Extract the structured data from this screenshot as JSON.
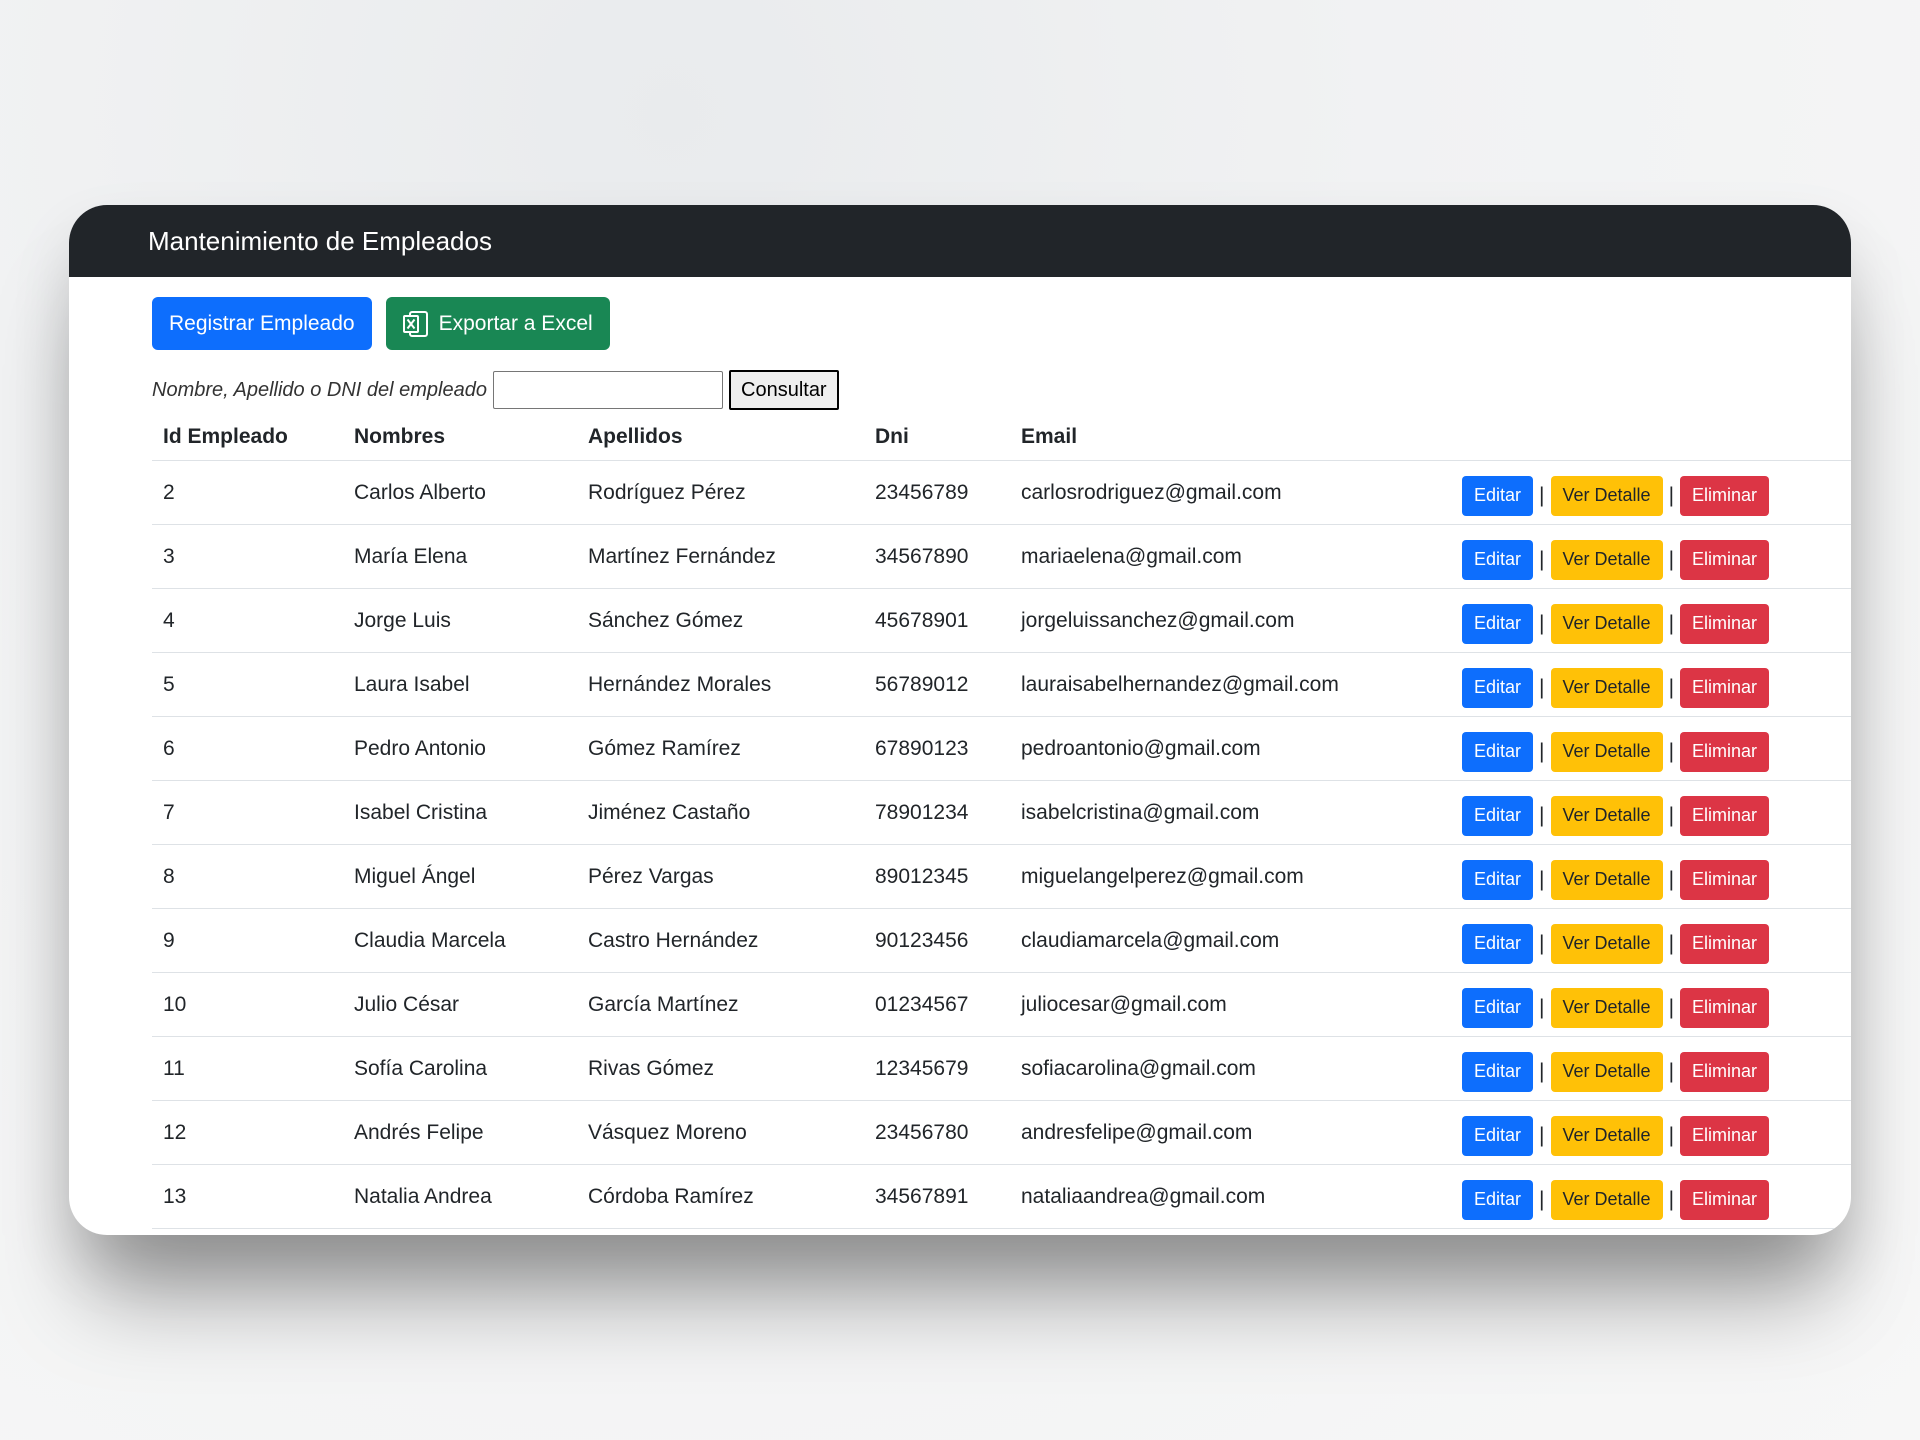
{
  "header": {
    "title": "Mantenimiento de Empleados"
  },
  "actions": {
    "register_label": "Registrar Empleado",
    "export_label": "Exportar a Excel",
    "export_icon": "excel-icon"
  },
  "search": {
    "label": "Nombre, Apellido o DNI del empleado",
    "value": "",
    "button_label": "Consultar"
  },
  "table": {
    "columns": [
      "Id Empleado",
      "Nombres",
      "Apellidos",
      "Dni",
      "Email",
      ""
    ],
    "row_actions": {
      "edit": "Editar",
      "detail": "Ver Detalle",
      "delete": "Eliminar",
      "separator": "|"
    },
    "rows": [
      {
        "id": "2",
        "nombres": "Carlos Alberto",
        "apellidos": "Rodríguez Pérez",
        "dni": "23456789",
        "email": "carlosrodriguez@gmail.com"
      },
      {
        "id": "3",
        "nombres": "María Elena",
        "apellidos": "Martínez Fernández",
        "dni": "34567890",
        "email": "mariaelena@gmail.com"
      },
      {
        "id": "4",
        "nombres": "Jorge Luis",
        "apellidos": "Sánchez Gómez",
        "dni": "45678901",
        "email": "jorgeluissanchez@gmail.com"
      },
      {
        "id": "5",
        "nombres": "Laura Isabel",
        "apellidos": "Hernández Morales",
        "dni": "56789012",
        "email": "lauraisabelhernandez@gmail.com"
      },
      {
        "id": "6",
        "nombres": "Pedro Antonio",
        "apellidos": "Gómez Ramírez",
        "dni": "67890123",
        "email": "pedroantonio@gmail.com"
      },
      {
        "id": "7",
        "nombres": "Isabel Cristina",
        "apellidos": "Jiménez Castaño",
        "dni": "78901234",
        "email": "isabelcristina@gmail.com"
      },
      {
        "id": "8",
        "nombres": "Miguel Ángel",
        "apellidos": "Pérez Vargas",
        "dni": "89012345",
        "email": "miguelangelperez@gmail.com"
      },
      {
        "id": "9",
        "nombres": "Claudia Marcela",
        "apellidos": "Castro Hernández",
        "dni": "90123456",
        "email": "claudiamarcela@gmail.com"
      },
      {
        "id": "10",
        "nombres": "Julio César",
        "apellidos": "García Martínez",
        "dni": "01234567",
        "email": "juliocesar@gmail.com"
      },
      {
        "id": "11",
        "nombres": "Sofía Carolina",
        "apellidos": "Rivas Gómez",
        "dni": "12345679",
        "email": "sofiacarolina@gmail.com"
      },
      {
        "id": "12",
        "nombres": "Andrés Felipe",
        "apellidos": "Vásquez Moreno",
        "dni": "23456780",
        "email": "andresfelipe@gmail.com"
      },
      {
        "id": "13",
        "nombres": "Natalia Andrea",
        "apellidos": "Córdoba Ramírez",
        "dni": "34567891",
        "email": "nataliaandrea@gmail.com"
      }
    ]
  },
  "colors": {
    "header_bg": "#212529",
    "primary": "#0d6efd",
    "success": "#198754",
    "warning": "#ffc107",
    "danger": "#dc3545"
  }
}
